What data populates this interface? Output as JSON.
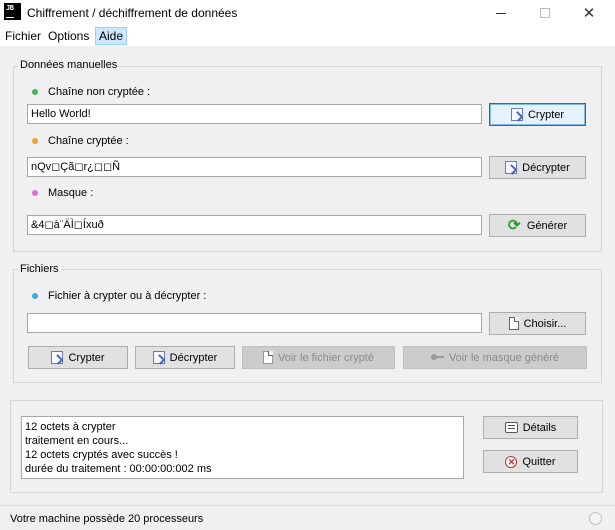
{
  "window": {
    "title": "Chiffrement / déchiffrement de données",
    "logo_text": "JB"
  },
  "menu": {
    "items": [
      {
        "label": "Fichier"
      },
      {
        "label": "Options"
      },
      {
        "label": "Aide",
        "active": true
      }
    ]
  },
  "manual": {
    "group_title": "Données manuelles",
    "plain": {
      "label": "Chaîne non cryptée :",
      "value": "Hello World!",
      "dot_color": "#4caf50",
      "button_label": "Crypter"
    },
    "encrypted": {
      "label": "Chaîne cryptée :",
      "value": "nQv◻Çã◻r¿◻◻Ñ",
      "dot_color": "#f0a030",
      "button_label": "Décrypter"
    },
    "mask": {
      "label": "Masque :",
      "value": "&4◻à¨ÄÌ◻Íxuð",
      "dot_color": "#e070d0",
      "button_label": "Générer"
    }
  },
  "files": {
    "group_title": "Fichiers",
    "file_label": "Fichier à crypter ou à décrypter :",
    "dot_color": "#40a8e0",
    "file_value": "",
    "choose_label": "Choisir...",
    "encrypt_label": "Crypter",
    "decrypt_label": "Décrypter",
    "view_encrypted_label": "Voir le fichier crypté",
    "view_mask_label": "Voir le masque généré"
  },
  "log": {
    "lines": [
      "12 octets à crypter",
      "traitement en cours...",
      "12 octets cryptés avec succès !",
      "durée du traitement : 00:00:00:002 ms"
    ],
    "details_label": "Détails",
    "quit_label": "Quitter"
  },
  "status": {
    "text": "Votre machine possède 20 processeurs"
  }
}
